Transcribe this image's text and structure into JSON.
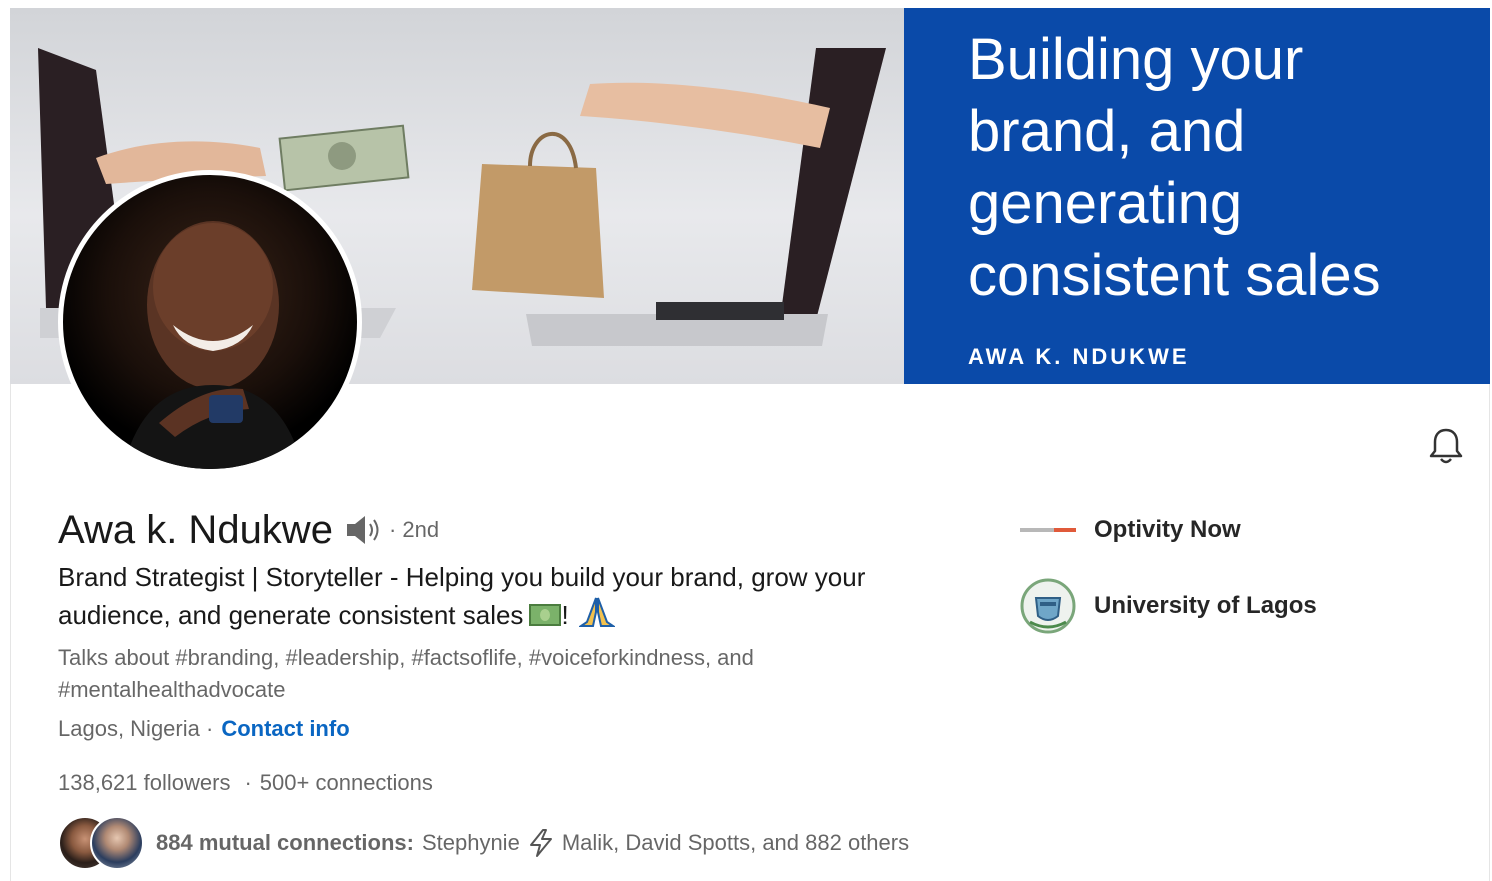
{
  "banner": {
    "headline": "Building your\nbrand, and\ngenerating\nconsistent sales",
    "sub": "AWA K. NDUKWE",
    "colors": {
      "panel": "#0a4aa9"
    }
  },
  "profile": {
    "name": "Awa k. Ndukwe",
    "degree": "· 2nd",
    "headline": "Brand Strategist | Storyteller - Helping you build your brand, grow your audience, and generate consistent sales",
    "headline_suffix": "!",
    "talks_about": "Talks about #branding, #leadership, #factsoflife, #voiceforkindness, and #mentalhealthadvocate",
    "location": "Lagos, Nigeria ·",
    "contact_label": "Contact info",
    "followers_count": "138,621",
    "followers_label": "followers",
    "connections_sep": "·",
    "connections_count": "500+",
    "connections_label": "connections"
  },
  "mutual": {
    "label": "884 mutual connections:",
    "names_before_bolt": "Stephynie",
    "names_after_bolt": "Malik, David Spotts, and 882 others"
  },
  "orgs": [
    {
      "name": "Optivity Now",
      "icon": "optivity-logo"
    },
    {
      "name": "University of Lagos",
      "icon": "unilag-crest"
    }
  ],
  "icons": {
    "notification": "bell-icon",
    "pronunciation": "speaker-icon"
  },
  "colors": {
    "link": "#0a66c2",
    "text_secondary": "rgba(0,0,0,0.6)"
  }
}
